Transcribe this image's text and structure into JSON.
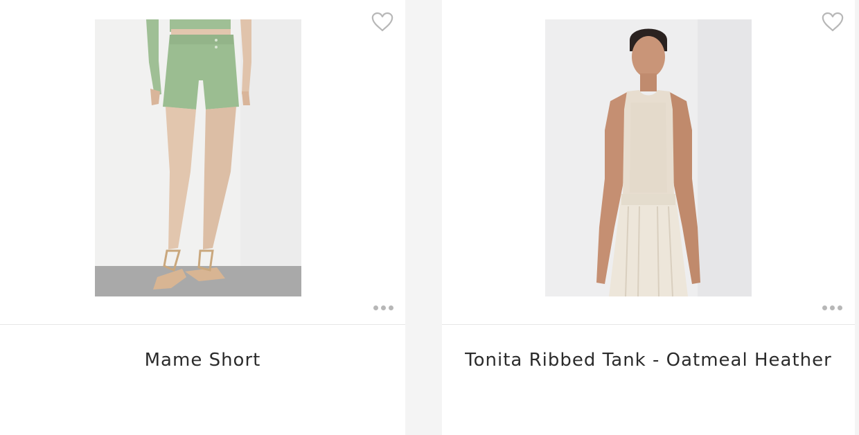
{
  "products": [
    {
      "name": "Mame Short",
      "image_alt": "Model wearing green shorts and lace-up sandals"
    },
    {
      "name": "Tonita Ribbed Tank - Oatmeal Heather",
      "image_alt": "Model wearing oatmeal ribbed tank and pleated pants"
    }
  ],
  "icons": {
    "wishlist": "heart-outline-icon",
    "more": "more-options-icon"
  },
  "colors": {
    "page_bg": "#f4f4f4",
    "card_bg": "#ffffff",
    "title_text": "#2b2b2b",
    "icon_gray": "#b7b7b7"
  }
}
